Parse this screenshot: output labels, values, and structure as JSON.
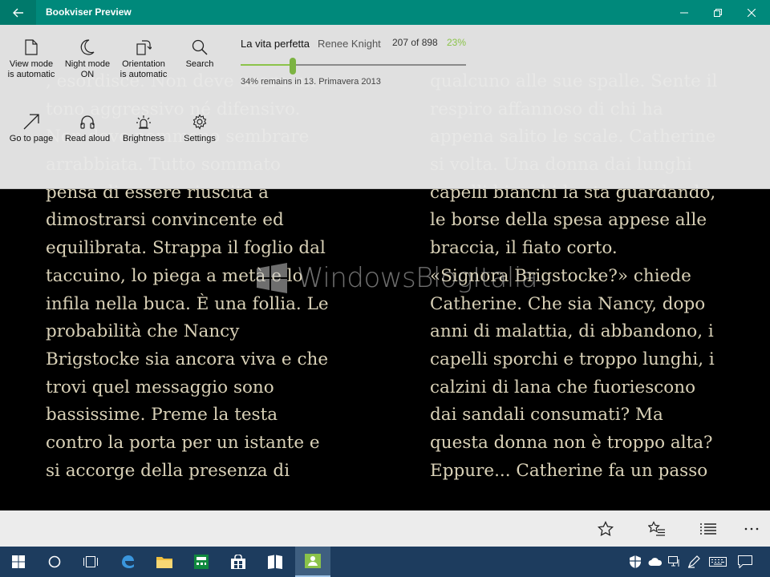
{
  "window": {
    "title": "Bookviser Preview"
  },
  "toolbar": {
    "view_mode": "View mode is automatic",
    "view_mode_l1": "View mode",
    "view_mode_l2": "is automatic",
    "night_l1": "Night mode",
    "night_l2": "ON",
    "orient_l1": "Orientation",
    "orient_l2": "is automatic",
    "search": "Search",
    "goto": "Go to page",
    "read_aloud": "Read aloud",
    "brightness": "Brightness",
    "settings": "Settings"
  },
  "book": {
    "title": "La vita perfetta",
    "author": "Renee Knight",
    "page_count": "207 of 898",
    "percent": "23%",
    "progress": 0.23,
    "remains": "34% remains in 13. Primavera 2013"
  },
  "text_left": [
    ", esordisce. Non deve usare un",
    "tono aggressivo né difensivo.",
    "Non deve nemmeno sembrare",
    "arrabbiata. Tutto sommato",
    "pensa di essere riuscita a",
    "dimostrarsi convincente ed",
    "equilibrata. Strappa il foglio dal",
    "taccuino, lo piega a metà e lo",
    "infila nella buca. È una follia. Le",
    "probabilità che Nancy",
    "Brigstocke sia ancora viva e che",
    "trovi quel messaggio sono",
    "bassissime. Preme la testa",
    "contro la porta per un istante e",
    "si accorge della presenza di"
  ],
  "text_right": [
    "qualcuno alle sue spalle. Sente il",
    "respiro affannoso di chi ha",
    "appena salito le scale. Catherine",
    "si volta. Una donna dai lunghi",
    "capelli bianchi la sta guardando,",
    "le borse della spesa appese alle",
    "braccia, il fiato corto.",
    "   «Signora Brigstocke?» chiede",
    "Catherine. Che sia Nancy, dopo",
    "anni di malattia, di abbandono, i",
    "capelli sporchi e troppo lunghi, i",
    "calzini di lana che fuoriescono",
    "dai sandali consumati? Ma",
    "questa donna non è troppo alta?",
    "Eppure... Catherine fa un passo"
  ],
  "watermark": "WindowsBlogItalia",
  "colors": {
    "accent": "#00897b",
    "progress": "#8bc34a",
    "text": "#d9d1b7",
    "taskbar": "#1d3c5e"
  }
}
